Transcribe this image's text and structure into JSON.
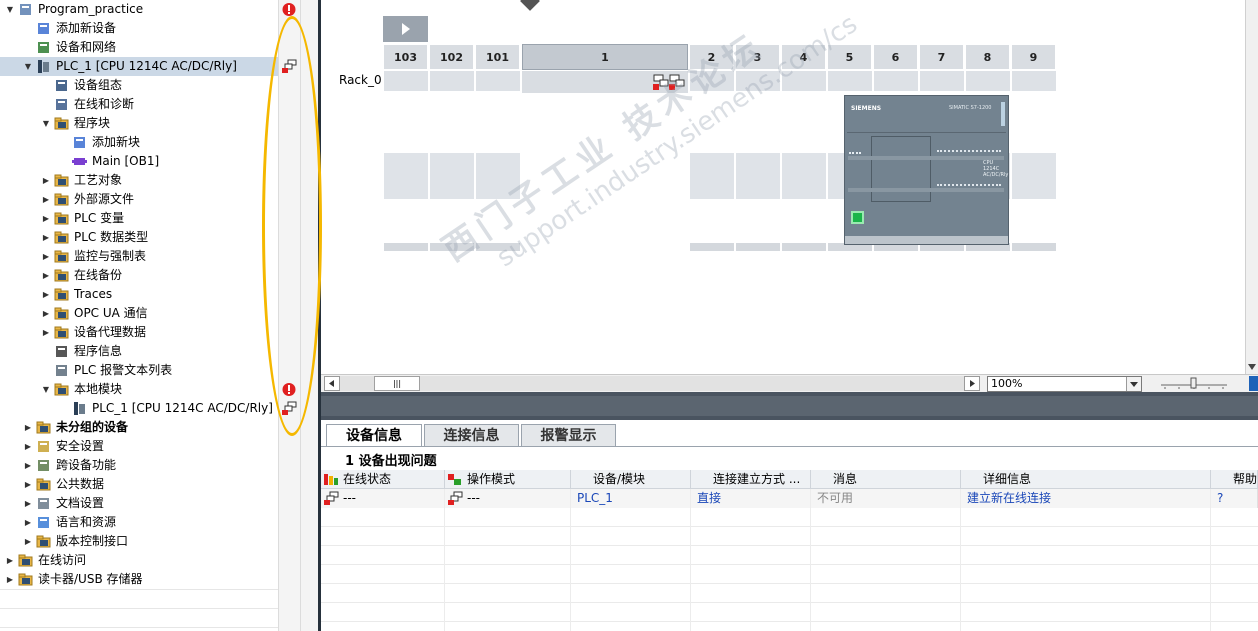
{
  "tree": {
    "items": [
      {
        "label": "Program_practice",
        "level": 0,
        "expander": "down",
        "icon": "project-icon",
        "bold": false,
        "status": "error-icon"
      },
      {
        "label": "添加新设备",
        "level": 1,
        "expander": "",
        "icon": "add-device-icon",
        "bold": false
      },
      {
        "label": "设备和网络",
        "level": 1,
        "expander": "",
        "icon": "network-icon",
        "bold": false
      },
      {
        "label": "PLC_1 [CPU 1214C AC/DC/Rly]",
        "level": 1,
        "expander": "down",
        "icon": "plc-icon",
        "bold": false,
        "selected": true,
        "status": "offline-icon"
      },
      {
        "label": "设备组态",
        "level": 2,
        "expander": "",
        "icon": "device-config-icon",
        "bold": false
      },
      {
        "label": "在线和诊断",
        "level": 2,
        "expander": "",
        "icon": "diagnostics-icon",
        "bold": false
      },
      {
        "label": "程序块",
        "level": 2,
        "expander": "down",
        "icon": "folder-icon",
        "bold": false
      },
      {
        "label": "添加新块",
        "level": 3,
        "expander": "",
        "icon": "add-block-icon",
        "bold": false
      },
      {
        "label": "Main [OB1]",
        "level": 3,
        "expander": "",
        "icon": "ob-icon",
        "bold": false
      },
      {
        "label": "工艺对象",
        "level": 2,
        "expander": "right",
        "icon": "folder-icon",
        "bold": false
      },
      {
        "label": "外部源文件",
        "level": 2,
        "expander": "right",
        "icon": "folder-icon",
        "bold": false
      },
      {
        "label": "PLC 变量",
        "level": 2,
        "expander": "right",
        "icon": "folder-icon",
        "bold": false
      },
      {
        "label": "PLC 数据类型",
        "level": 2,
        "expander": "right",
        "icon": "folder-icon",
        "bold": false
      },
      {
        "label": "监控与强制表",
        "level": 2,
        "expander": "right",
        "icon": "folder-icon",
        "bold": false
      },
      {
        "label": "在线备份",
        "level": 2,
        "expander": "right",
        "icon": "folder-icon",
        "bold": false
      },
      {
        "label": "Traces",
        "level": 2,
        "expander": "right",
        "icon": "folder-icon",
        "bold": false
      },
      {
        "label": "OPC UA 通信",
        "level": 2,
        "expander": "right",
        "icon": "folder-icon",
        "bold": false
      },
      {
        "label": "设备代理数据",
        "level": 2,
        "expander": "right",
        "icon": "folder-icon",
        "bold": false
      },
      {
        "label": "程序信息",
        "level": 2,
        "expander": "",
        "icon": "info-icon",
        "bold": false
      },
      {
        "label": "PLC 报警文本列表",
        "level": 2,
        "expander": "",
        "icon": "list-icon",
        "bold": false
      },
      {
        "label": "本地模块",
        "level": 2,
        "expander": "down",
        "icon": "folder-icon",
        "bold": false,
        "status": "error-icon"
      },
      {
        "label": "PLC_1 [CPU 1214C AC/DC/Rly]",
        "level": 3,
        "expander": "",
        "icon": "plc-icon",
        "bold": false,
        "status": "offline-icon"
      },
      {
        "label": "未分组的设备",
        "level": 1,
        "expander": "right",
        "icon": "folder-icon",
        "bold": true
      },
      {
        "label": "安全设置",
        "level": 1,
        "expander": "right",
        "icon": "security-icon",
        "bold": false
      },
      {
        "label": "跨设备功能",
        "level": 1,
        "expander": "right",
        "icon": "cross-device-icon",
        "bold": false
      },
      {
        "label": "公共数据",
        "level": 1,
        "expander": "right",
        "icon": "folder-icon",
        "bold": false
      },
      {
        "label": "文档设置",
        "level": 1,
        "expander": "right",
        "icon": "document-icon",
        "bold": false
      },
      {
        "label": "语言和资源",
        "level": 1,
        "expander": "right",
        "icon": "language-icon",
        "bold": false
      },
      {
        "label": "版本控制接口",
        "level": 1,
        "expander": "right",
        "icon": "folder-icon",
        "bold": false
      },
      {
        "label": "在线访问",
        "level": 0,
        "expander": "right",
        "icon": "online-access-icon",
        "bold": false
      },
      {
        "label": "读卡器/USB 存储器",
        "level": 0,
        "expander": "right",
        "icon": "card-reader-icon",
        "bold": false
      }
    ]
  },
  "rack": {
    "name": "Rack_0",
    "slots": [
      "103",
      "102",
      "101",
      "1",
      "2",
      "3",
      "4",
      "5",
      "6",
      "7",
      "8",
      "9"
    ],
    "module_brand": "SIEMENS",
    "module_model": "SIMATIC S7-1200",
    "module_type": "CPU 1214C AC/DC/Rly"
  },
  "canvas": {
    "zoom": "100%",
    "scroll_label": "|||"
  },
  "bottom": {
    "tabs": [
      "设备信息",
      "连接信息",
      "报警显示"
    ],
    "active_tab": 0,
    "issue_header": "1 设备出现问题",
    "columns": [
      "在线状态",
      "操作模式",
      "设备/模块",
      "连接建立方式 ...",
      "消息",
      "详细信息",
      "帮助"
    ],
    "rows": [
      [
        "---",
        "---",
        "PLC_1",
        "直接",
        "不可用",
        "建立新在线连接",
        "?"
      ]
    ]
  },
  "colors": {
    "selection": "#cbd8e6",
    "link": "#1a47b8",
    "module": "#738390",
    "annotation_oval": "#f5b800"
  }
}
